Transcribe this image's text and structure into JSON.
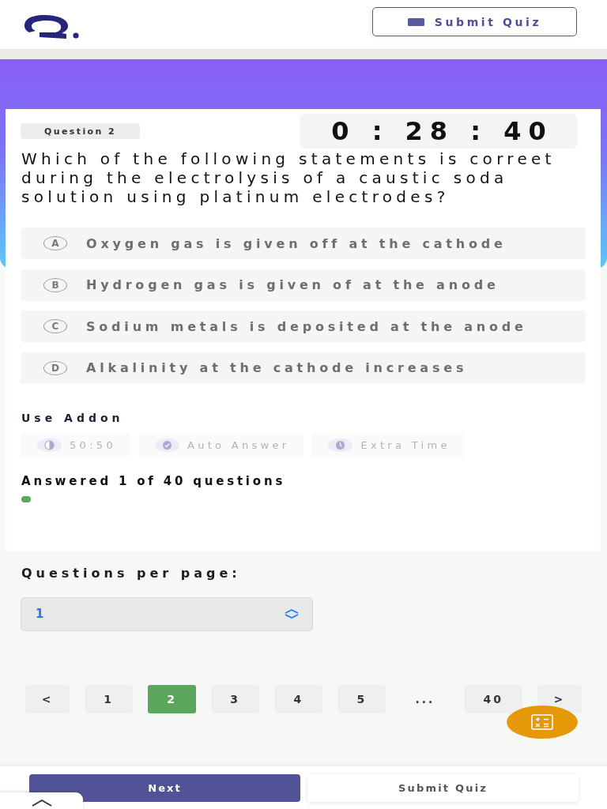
{
  "header": {
    "submit_label": "Submit Quiz"
  },
  "question": {
    "label": "Question 2",
    "timer": "0 : 28 : 40",
    "text": "Which of the following statements is correet during the electrolysis of a caustic soda solution using platinum electrodes?"
  },
  "options": [
    {
      "letter": "A",
      "text": "Oxygen gas is given off at the cathode",
      "selected": false
    },
    {
      "letter": "B",
      "text": "Hydrogen gas is given of at the anode",
      "selected": false
    },
    {
      "letter": "C",
      "text": "Sodium metals is deposited at the anode",
      "selected": false
    },
    {
      "letter": "D",
      "text": "Alkalinity at the cathode increases",
      "selected": false
    }
  ],
  "addons": {
    "title": "Use Addon",
    "items": [
      {
        "kind": "fifty",
        "label": "50:50",
        "disabled": true
      },
      {
        "kind": "auto",
        "label": "Auto Answer",
        "disabled": true
      },
      {
        "kind": "time",
        "label": "Extra Time",
        "disabled": true
      }
    ]
  },
  "progress": {
    "text": "Answered 1 of 40 questions",
    "level": 0.025
  },
  "per_page": {
    "label": "Questions per page:",
    "value": "1"
  },
  "pagination": [
    {
      "kind": "arrow",
      "label": "<",
      "selected": false
    },
    {
      "kind": "page",
      "label": "1",
      "selected": false
    },
    {
      "kind": "page",
      "label": "2",
      "selected": true
    },
    {
      "kind": "page",
      "label": "3",
      "selected": false
    },
    {
      "kind": "page",
      "label": "4",
      "selected": false
    },
    {
      "kind": "page",
      "label": "5",
      "selected": false
    },
    {
      "kind": "gap",
      "label": "...",
      "selected": false
    },
    {
      "kind": "page",
      "label": "40",
      "selected": false
    },
    {
      "kind": "arrow",
      "label": ">",
      "selected": false
    }
  ],
  "footer": {
    "next_label": "Next",
    "submit_label": "Submit Quiz"
  }
}
